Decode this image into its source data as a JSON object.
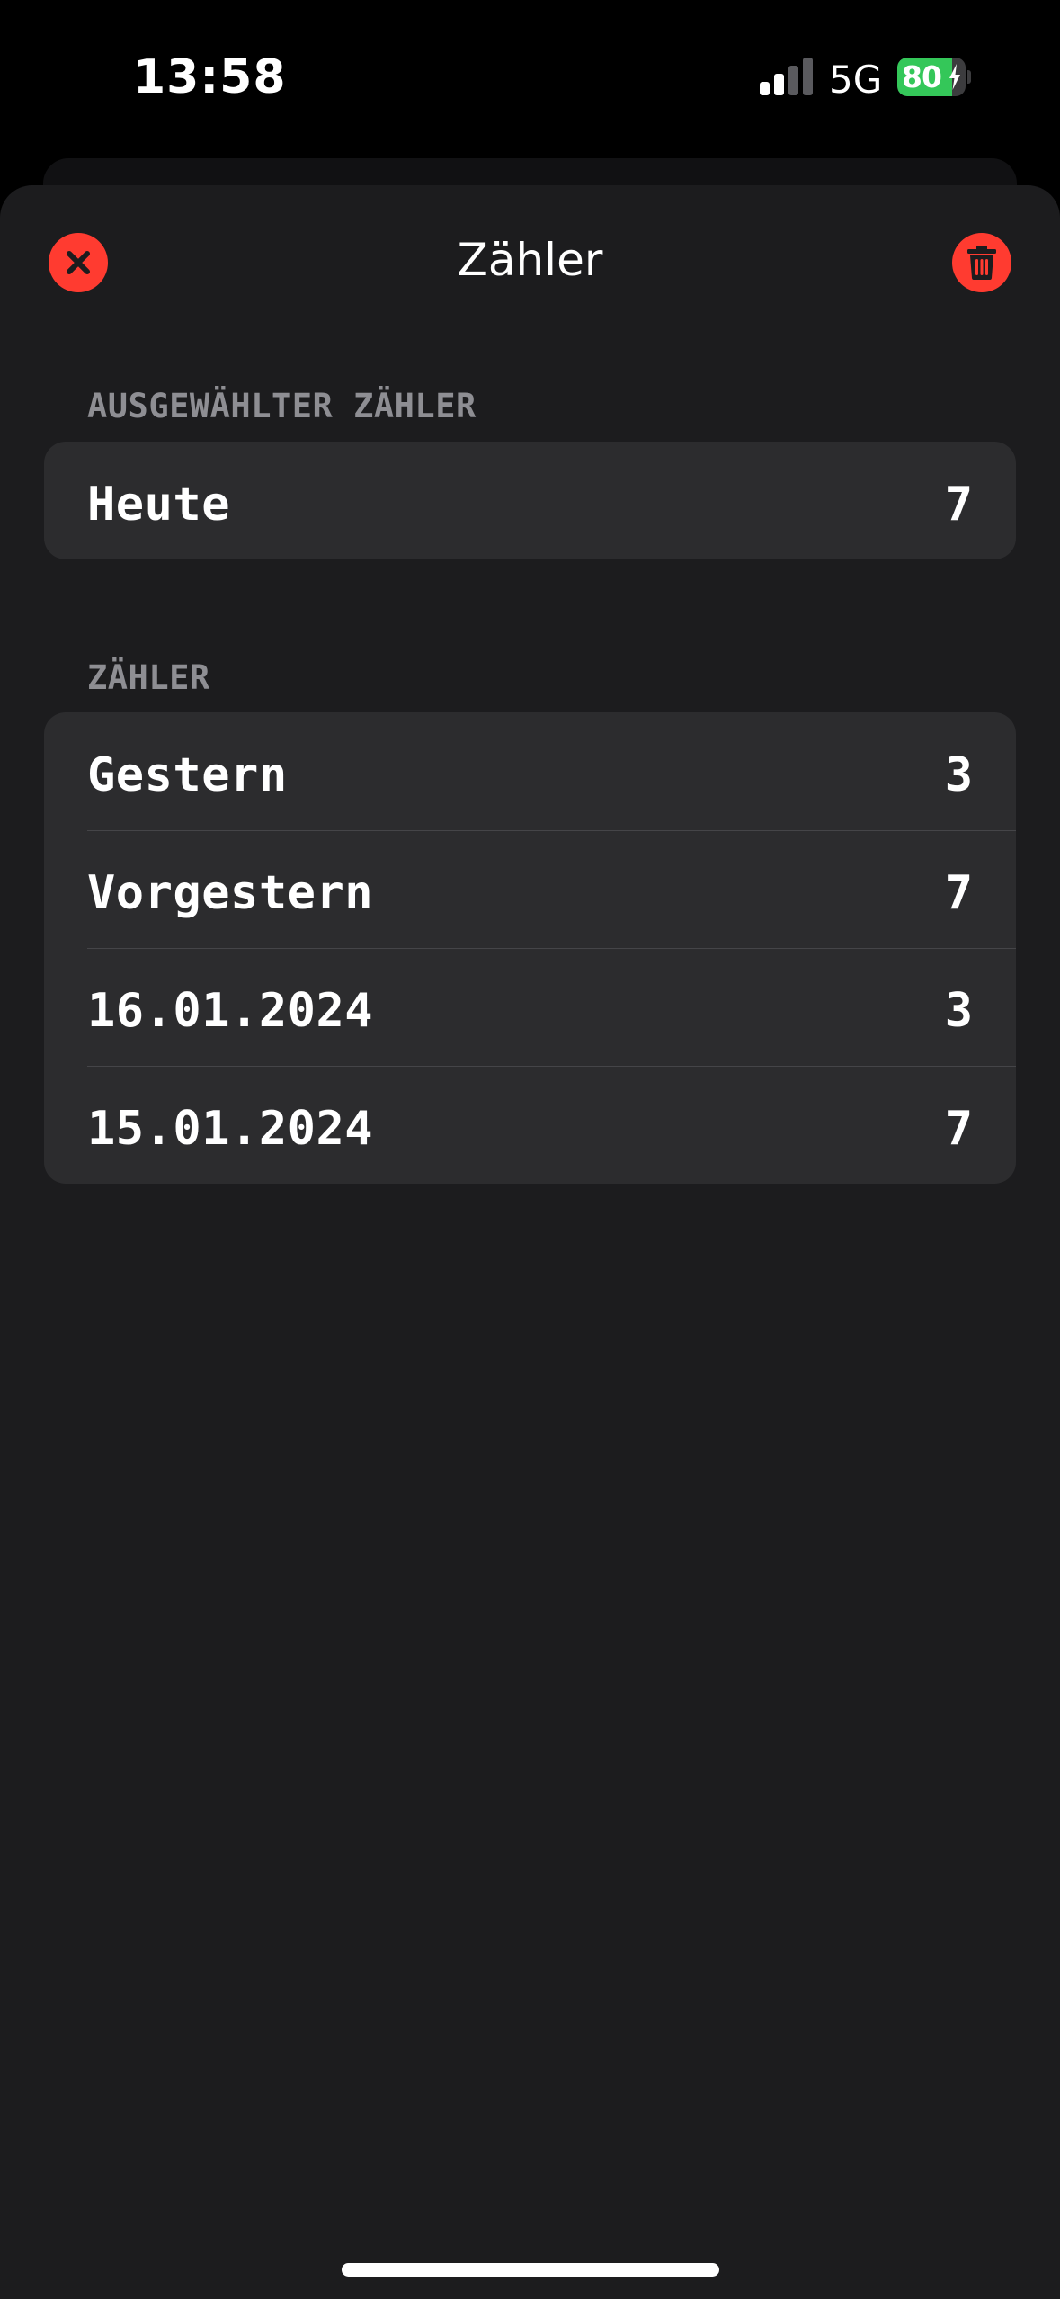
{
  "status_bar": {
    "time": "13:58",
    "network": "5G",
    "battery_percent": "80",
    "battery_level": 0.8,
    "signal_bars_active": 2,
    "signal_bars_total": 4
  },
  "sheet": {
    "title": "Zähler",
    "close_icon": "close-icon",
    "delete_icon": "trash-icon"
  },
  "selected_section": {
    "header": "AUSGEWÄHLTER ZÄHLER",
    "rows": [
      {
        "label": "Heute",
        "value": "7"
      }
    ]
  },
  "counters_section": {
    "header": "ZÄHLER",
    "rows": [
      {
        "label": "Gestern",
        "value": "3"
      },
      {
        "label": "Vorgestern",
        "value": "7"
      },
      {
        "label": "16.01.2024",
        "value": "3"
      },
      {
        "label": "15.01.2024",
        "value": "7"
      }
    ]
  },
  "colors": {
    "background": "#000000",
    "sheet": "#1c1c1e",
    "grouped_cell": "#2c2c2e",
    "destructive": "#ff3b30",
    "secondary_text": "#8e8e93",
    "battery_green": "#34c759"
  }
}
